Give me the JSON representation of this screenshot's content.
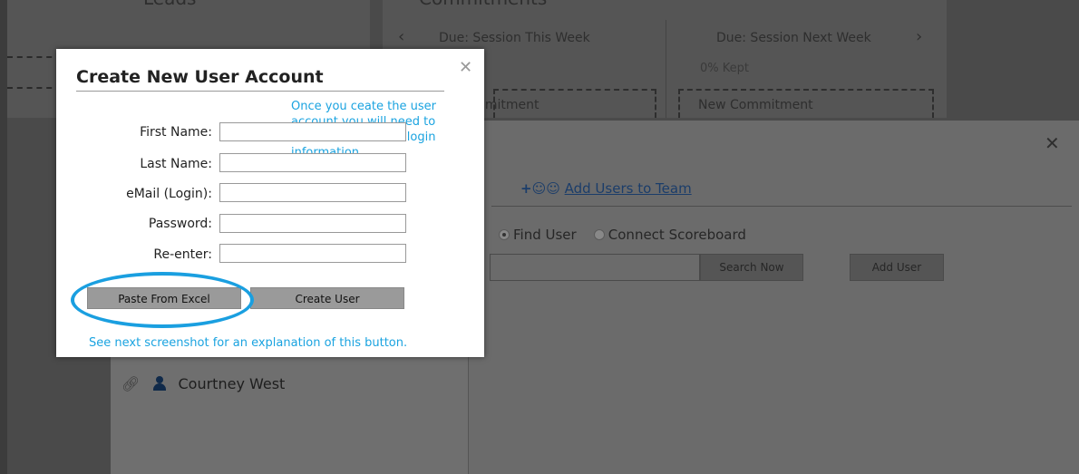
{
  "background": {
    "leads_title": "Leads",
    "commitments": {
      "title": "Commitments",
      "col1": "Due: Session This Week",
      "col2": "Due: Session Next Week",
      "kept": "0% Kept",
      "box1_label": "nmitment",
      "box2_label": "New Commitment"
    },
    "team_dialog": {
      "tab_label": "Add Users to Team",
      "radio_find": "Find User",
      "radio_connect": "Connect Scoreboard",
      "search_button": "Search Now",
      "add_button": "Add User",
      "contact_name": "Courtney West"
    }
  },
  "modal": {
    "title": "Create New User Account",
    "note_top": "Once you ceate the user account you will need to send the user their login information.",
    "fields": [
      {
        "label": "First Name:",
        "value": ""
      },
      {
        "label": "Last Name:",
        "value": ""
      },
      {
        "label": "eMail (Login):",
        "value": ""
      },
      {
        "label": "Password:",
        "value": ""
      },
      {
        "label": "Re-enter:",
        "value": ""
      }
    ],
    "paste_button": "Paste From Excel",
    "create_button": "Create User",
    "note_bottom": "See next screenshot for an explanation of this button."
  },
  "colors": {
    "annotation": "#1a9fe0",
    "button_gray": "#9a9a9a"
  }
}
